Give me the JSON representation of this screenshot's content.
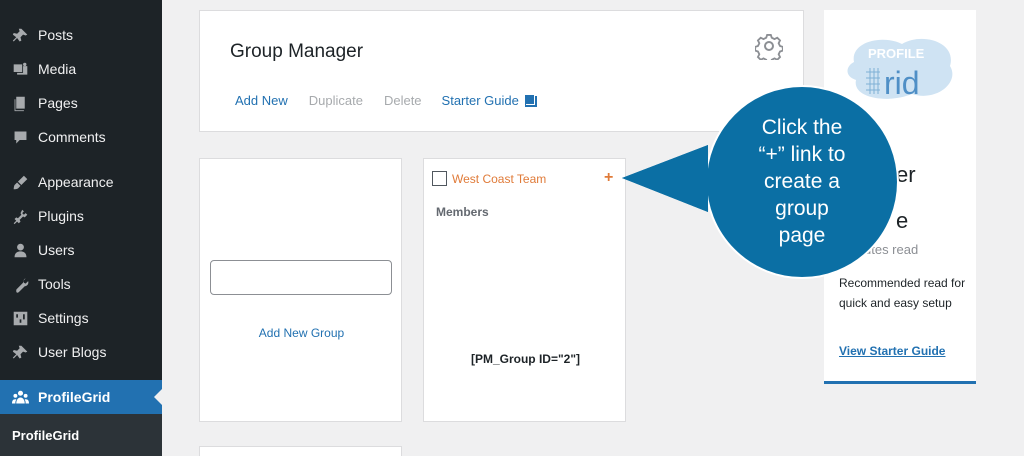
{
  "sidebar": {
    "items": [
      {
        "label": "Posts",
        "icon": "pin-icon"
      },
      {
        "label": "Media",
        "icon": "media-icon"
      },
      {
        "label": "Pages",
        "icon": "pages-icon"
      },
      {
        "label": "Comments",
        "icon": "comment-icon"
      },
      {
        "label": "Appearance",
        "icon": "brush-icon"
      },
      {
        "label": "Plugins",
        "icon": "plug-icon"
      },
      {
        "label": "Users",
        "icon": "user-icon"
      },
      {
        "label": "Tools",
        "icon": "wrench-icon"
      },
      {
        "label": "Settings",
        "icon": "settings-icon"
      },
      {
        "label": "User Blogs",
        "icon": "pin-icon"
      },
      {
        "label": "ProfileGrid",
        "icon": "group-icon"
      }
    ],
    "submenu_label": "ProfileGrid"
  },
  "header": {
    "title": "Group Manager",
    "add_new": "Add New",
    "duplicate": "Duplicate",
    "delete": "Delete",
    "starter_guide": "Starter Guide"
  },
  "add_group": {
    "input_value": "",
    "link": "Add New Group"
  },
  "group_card": {
    "name": "West Coast Team",
    "plus": "+",
    "members_label": "Members",
    "shortcode": "[PM_Group ID=\"2\"]"
  },
  "side_panel": {
    "logo_top": "PROFILE",
    "logo_bottom": "rid",
    "partial_line1": "er",
    "partial_line2": "e",
    "read_time": "utes read",
    "recommend": "Recommended read for quick and easy setup",
    "view_guide": "View Starter Guide"
  },
  "callout": {
    "lines": [
      "Click the",
      "“+” link to",
      "create a",
      "group",
      "page"
    ]
  },
  "colors": {
    "sidebar_bg": "#1d2327",
    "active_bg": "#2271b1",
    "link": "#2271b1",
    "group_accent": "#e07b39",
    "callout": "#0b6fa4"
  }
}
